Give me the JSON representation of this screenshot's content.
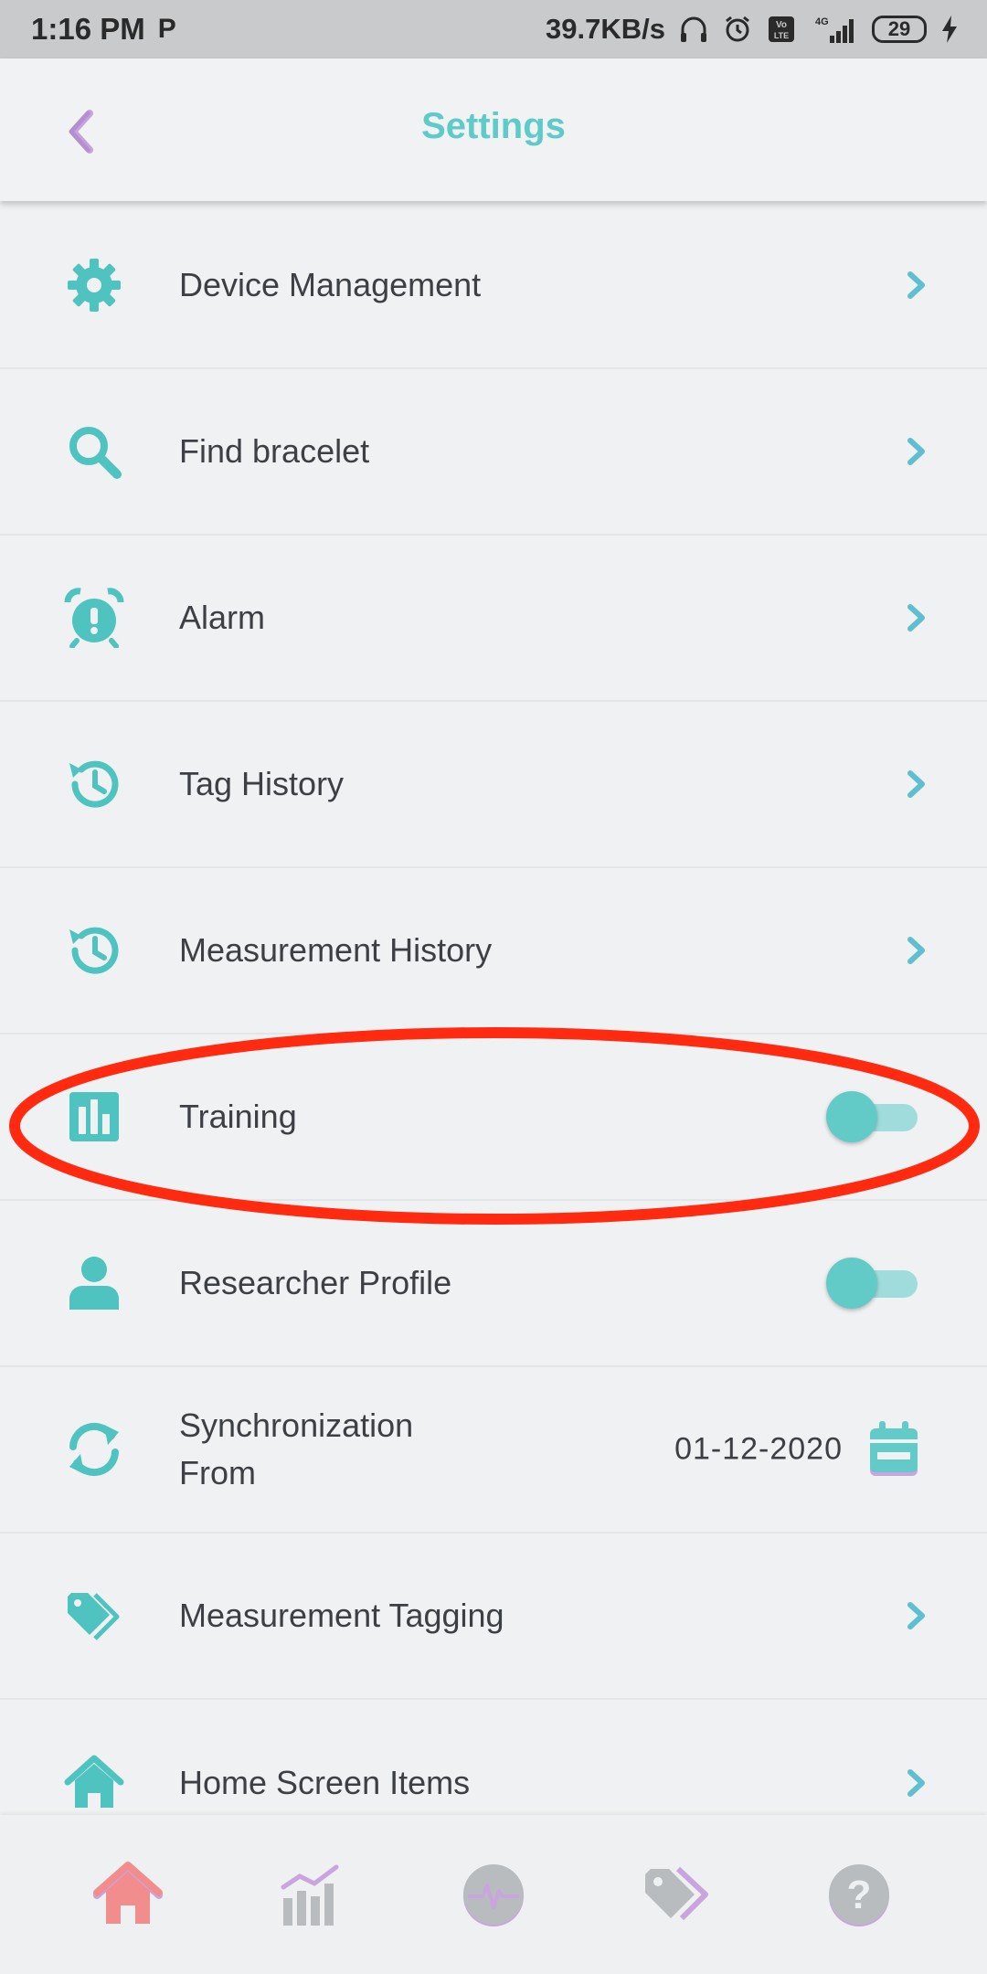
{
  "status_bar": {
    "time": "1:16 PM",
    "carrier_icon_letter": "P",
    "net_speed": "39.7KB/s",
    "battery_level": "29",
    "network_type": "4G",
    "volte_label": "Vo LTE"
  },
  "header": {
    "title": "Settings"
  },
  "settings": {
    "items": [
      {
        "label": "Device Management",
        "icon": "gear-icon"
      },
      {
        "label": "Find bracelet",
        "icon": "search-icon"
      },
      {
        "label": "Alarm",
        "icon": "alarm-clock-icon"
      },
      {
        "label": "Tag History",
        "icon": "history-icon"
      },
      {
        "label": "Measurement History",
        "icon": "history-icon"
      },
      {
        "label": "Training",
        "icon": "bar-chart-icon",
        "toggle": "off"
      },
      {
        "label": "Researcher Profile",
        "icon": "user-icon",
        "toggle": "off"
      },
      {
        "label": "Synchronization\nFrom",
        "icon": "sync-icon",
        "value": "01-12-2020"
      },
      {
        "label": "Measurement Tagging",
        "icon": "tag-icon"
      },
      {
        "label": "Home Screen Items",
        "icon": "home-icon"
      }
    ]
  },
  "bottom_nav": {
    "items": [
      "home-icon",
      "stats-icon",
      "heart-rate-icon",
      "tags-icon",
      "help-icon"
    ],
    "active": "home-icon"
  },
  "colors": {
    "accent": "#5fcbc8",
    "highlight_annotation": "#ff2a10",
    "nav_active": "#f28d8d",
    "nav_inactive": "#b9bcbf"
  }
}
